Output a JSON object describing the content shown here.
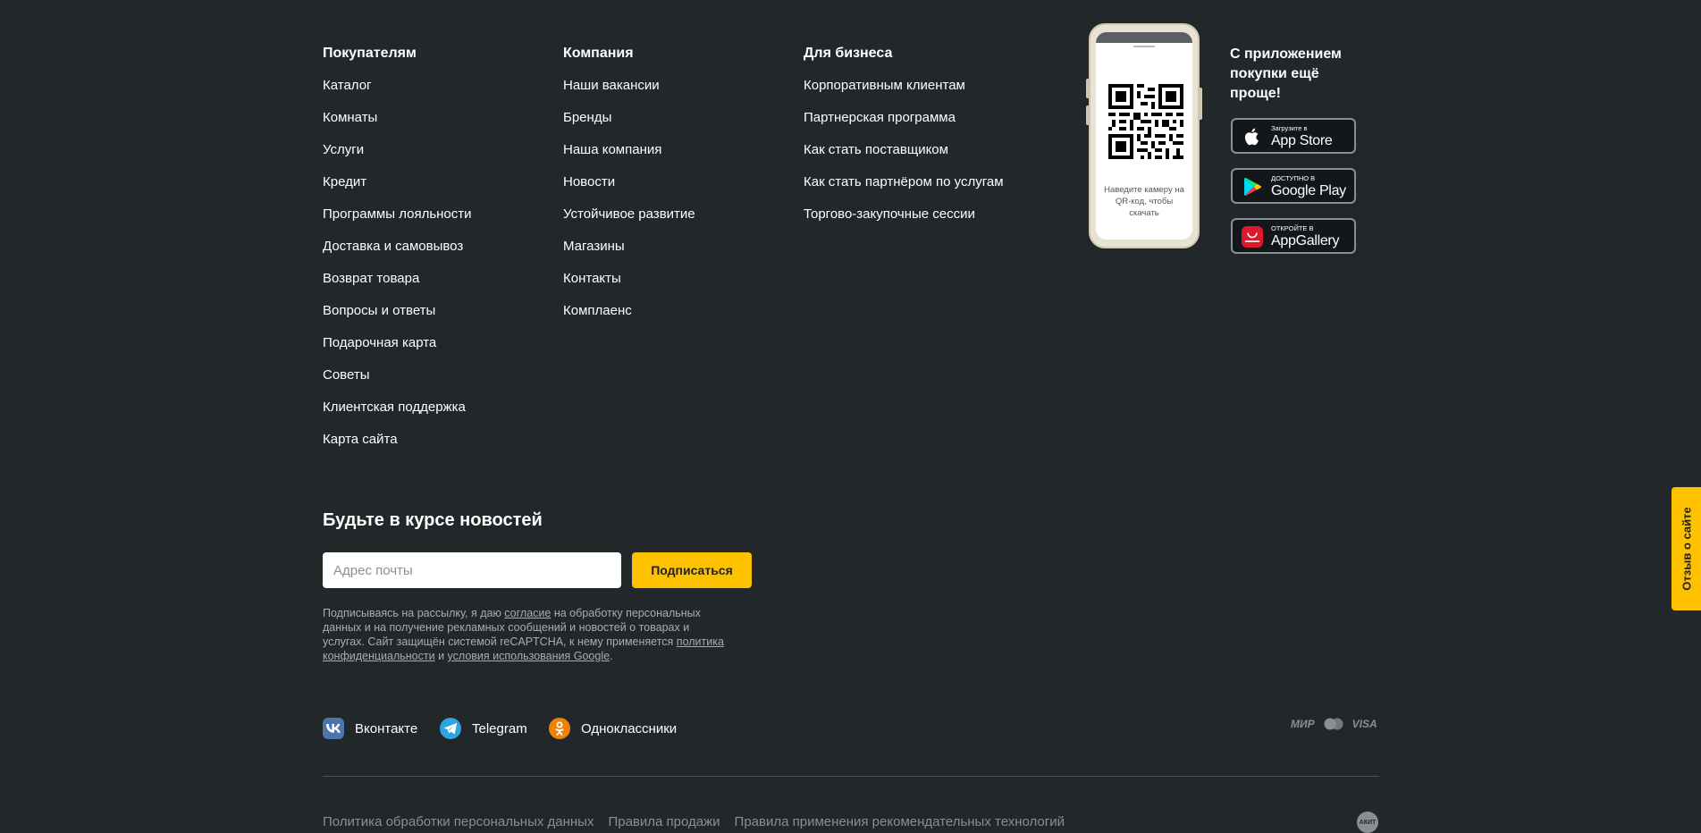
{
  "columns": [
    {
      "title": "Покупателям",
      "links": [
        "Каталог",
        "Комнаты",
        "Услуги",
        "Кредит",
        "Программы лояльности",
        "Доставка и самовывоз",
        "Возврат товара",
        "Вопросы и ответы",
        "Подарочная карта",
        "Советы",
        "Клиентская поддержка",
        "Карта сайта"
      ]
    },
    {
      "title": "Компания",
      "links": [
        "Наши вакансии",
        "Бренды",
        "Наша компания",
        "Новости",
        "Устойчивое развитие",
        "Магазины",
        "Контакты",
        "Комплаенс"
      ]
    },
    {
      "title": "Для бизнеса",
      "links": [
        "Корпоративным клиентам",
        "Партнерская программа",
        "Как стать поставщиком",
        "Как стать партнёром по услугам",
        "Торгово-закупочные сессии"
      ]
    }
  ],
  "app": {
    "qr_hint": "Наведите камеру на QR-код, чтобы скачать",
    "title": "С приложением покупки ещё проще!",
    "stores": [
      {
        "small": "Загрузите в",
        "big": "App Store",
        "icon": "apple-icon"
      },
      {
        "small": "ДОСТУПНО В",
        "big": "Google Play",
        "icon": "google-play-icon"
      },
      {
        "small": "ОТКРОЙТЕ В",
        "big": "AppGallery",
        "icon": "huawei-appgallery-icon"
      }
    ]
  },
  "newsletter": {
    "title": "Будьте в курсе новостей",
    "placeholder": "Адрес почты",
    "button": "Подписаться",
    "legal": {
      "p1": "Подписываясь на рассылку, я даю ",
      "link1": "согласие",
      "p2": " на обработку персональных данных и на получение рекламных сообщений и новостей о товарах и услугах. Сайт защищён системой reCAPTCHA, к нему применяется ",
      "link2": "политика конфиденциальности",
      "p3": " и ",
      "link3": "условия использования Google",
      "p4": "."
    }
  },
  "socials": [
    {
      "label": "Вконтакте",
      "icon": "vk-icon",
      "color": "#4a76a8"
    },
    {
      "label": "Telegram",
      "icon": "telegram-icon",
      "color": "#2ca5e0"
    },
    {
      "label": "Одноклассники",
      "icon": "odnoklassniki-icon",
      "color": "#ee8208"
    }
  ],
  "payments": {
    "mir": "МИР",
    "visa": "VISA"
  },
  "bottom_links": [
    "Политика обработки персональных данных",
    "Правила продажи",
    "Правила применения рекомендательных технологий"
  ],
  "akit_badge": "АКИТ",
  "feedback_tab": "Отзыв о сайте",
  "colors": {
    "background": "#22272a",
    "accent": "#fdc100"
  }
}
